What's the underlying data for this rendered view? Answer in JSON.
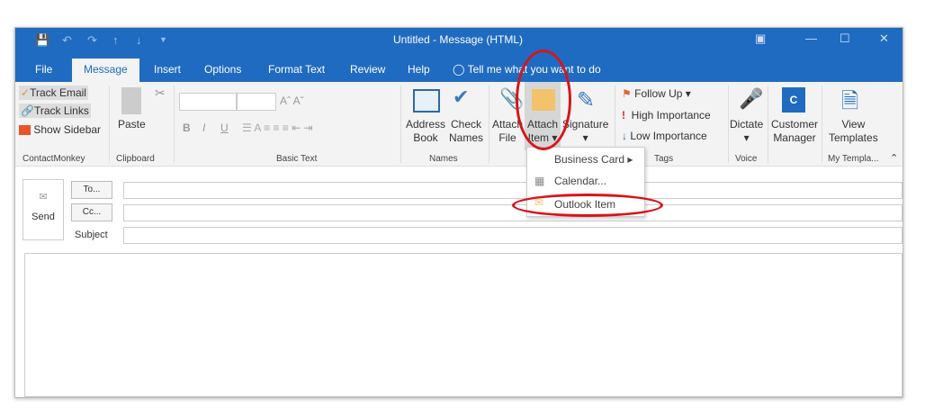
{
  "window": {
    "title": "Untitled  -  Message (HTML)"
  },
  "tabs": [
    "File",
    "Message",
    "Insert",
    "Options",
    "Format Text",
    "Review",
    "Help"
  ],
  "tell_me": "Tell me what you want to do",
  "ribbon": {
    "contactmonkey": {
      "track_email": "Track Email",
      "track_links": "Track Links",
      "show_sidebar": "Show Sidebar",
      "group": "ContactMonkey"
    },
    "clipboard": {
      "paste": "Paste",
      "group": "Clipboard"
    },
    "basic_text": {
      "group": "Basic Text",
      "bold": "B",
      "italic": "I",
      "underline": "U"
    },
    "names": {
      "address_book": [
        "Address",
        "Book"
      ],
      "check_names": [
        "Check",
        "Names"
      ],
      "group": "Names"
    },
    "include": {
      "attach_file": [
        "Attach",
        "File"
      ],
      "attach_item": [
        "Attach",
        "Item"
      ],
      "signature": "Signature"
    },
    "tags": {
      "follow_up": "Follow Up",
      "high": "High Importance",
      "low": "Low Importance",
      "group": "Tags"
    },
    "voice": {
      "dictate": "Dictate",
      "group": "Voice"
    },
    "customer_manager": [
      "Customer",
      "Manager"
    ],
    "templates": {
      "view": [
        "View",
        "Templates"
      ],
      "group": "My Templa..."
    }
  },
  "attach_menu": [
    "Business Card",
    "Calendar...",
    "Outlook Item"
  ],
  "compose": {
    "send": "Send",
    "to": "To...",
    "cc": "Cc...",
    "subject": "Subject"
  },
  "colors": {
    "titlebar": "#1f6bc1",
    "annotation": "#d8141b"
  }
}
